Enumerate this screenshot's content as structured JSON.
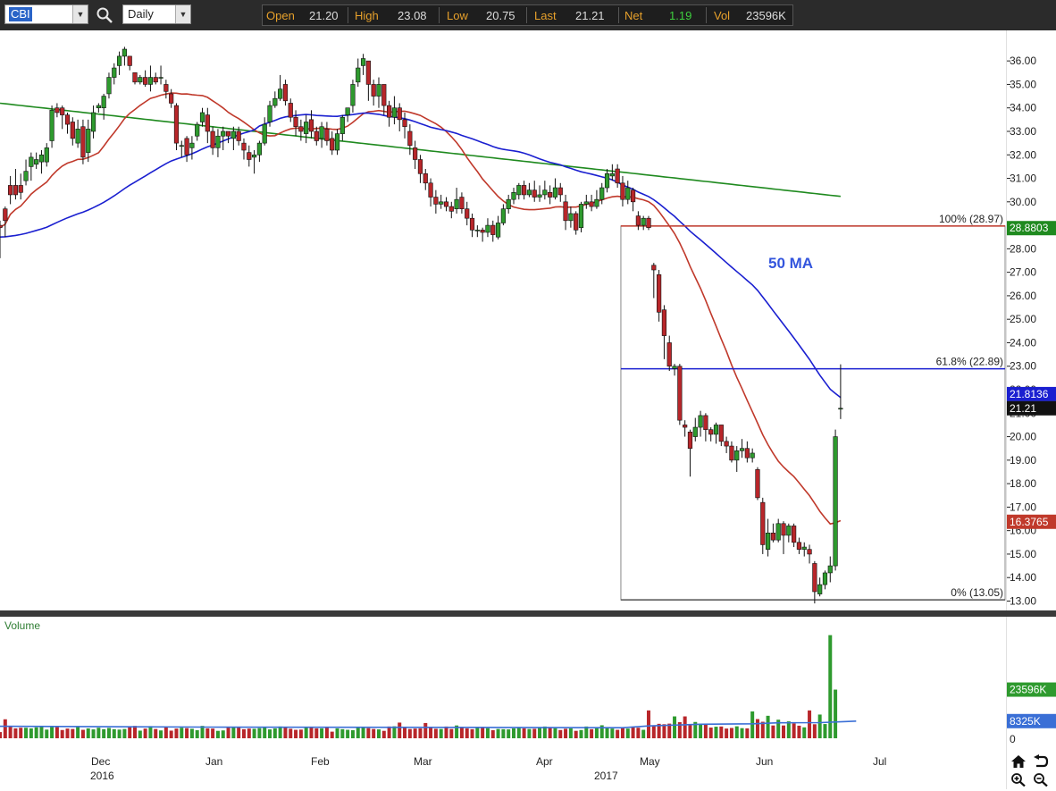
{
  "toolbar": {
    "symbol": "CBI",
    "period": "Daily",
    "quote": {
      "open_label": "Open",
      "open": "21.20",
      "high_label": "High",
      "high": "23.08",
      "low_label": "Low",
      "low": "20.75",
      "last_label": "Last",
      "last": "21.21",
      "net_label": "Net",
      "net": "1.19",
      "vol_label": "Vol",
      "vol": "23596K"
    },
    "icons": {
      "search": "search-icon",
      "dropdown": "chevron-down-icon"
    }
  },
  "colors": {
    "up": "#2e9a2e",
    "down": "#b8262a",
    "ma_short": "#c0392b",
    "ma50": "#1a1fd0",
    "ma200": "#1f8a1f",
    "fib_100": "#c0392b",
    "fib_618": "#1a1fd0",
    "volume_avg": "#3a6fd6"
  },
  "chart_data": {
    "type": "candlestick",
    "symbol": "CBI",
    "y_axis": {
      "ticks": [
        "13.00",
        "14.00",
        "15.00",
        "16.00",
        "17.00",
        "18.00",
        "19.00",
        "20.00",
        "21.00",
        "22.00",
        "23.00",
        "24.00",
        "25.00",
        "26.00",
        "27.00",
        "28.00",
        "29.00",
        "30.00",
        "31.00",
        "32.00",
        "33.00",
        "34.00",
        "35.00",
        "36.00"
      ],
      "ylim": [
        12.6,
        37.3
      ]
    },
    "x_axis": {
      "months": [
        "Dec",
        "Jan",
        "Feb",
        "Mar",
        "Apr",
        "May",
        "Jun",
        "Jul"
      ],
      "years": [
        {
          "label": "2016",
          "under": "Dec"
        },
        {
          "label": "2017",
          "under": "Apr-May"
        }
      ]
    },
    "candles": [
      [
        29.0,
        28.9,
        29.2,
        27.6
      ],
      [
        29.7,
        29.2,
        29.8,
        28.5
      ],
      [
        30.7,
        30.3,
        31.1,
        29.9
      ],
      [
        30.7,
        30.3,
        31.4,
        30.1
      ],
      [
        30.7,
        30.4,
        31.2,
        30.1
      ],
      [
        30.9,
        31.3,
        31.8,
        30.7
      ],
      [
        31.5,
        31.9,
        32.1,
        30.9
      ],
      [
        31.6,
        31.8,
        32.1,
        31.4
      ],
      [
        31.7,
        32.0,
        32.2,
        31.2
      ],
      [
        31.7,
        32.3,
        32.5,
        31.5
      ],
      [
        32.6,
        33.9,
        34.1,
        32.3
      ],
      [
        34.0,
        33.8,
        34.2,
        33.6
      ],
      [
        34.0,
        33.7,
        34.1,
        33.1
      ],
      [
        33.7,
        33.3,
        33.8,
        32.9
      ],
      [
        33.4,
        32.7,
        33.6,
        32.4
      ],
      [
        32.5,
        33.1,
        33.5,
        32.3
      ],
      [
        33.2,
        31.9,
        33.5,
        31.6
      ],
      [
        32.1,
        33.1,
        33.5,
        31.7
      ],
      [
        33.0,
        33.8,
        34.1,
        32.7
      ],
      [
        34.0,
        34.1,
        34.2,
        33.8
      ],
      [
        34.0,
        34.5,
        34.6,
        33.5
      ],
      [
        34.6,
        35.3,
        35.5,
        34.4
      ],
      [
        35.3,
        35.7,
        35.9,
        35.0
      ],
      [
        35.8,
        36.2,
        36.4,
        35.4
      ],
      [
        36.2,
        36.5,
        36.6,
        35.8
      ],
      [
        36.2,
        35.8,
        36.2,
        35.6
      ],
      [
        35.5,
        35.1,
        35.5,
        35.0
      ],
      [
        35.1,
        35.3,
        35.4,
        35.0
      ],
      [
        35.3,
        35.0,
        35.6,
        34.9
      ],
      [
        35.0,
        35.3,
        35.8,
        34.7
      ],
      [
        35.3,
        35.1,
        35.5,
        35.0
      ],
      [
        35.3,
        35.3,
        35.8,
        35.0
      ],
      [
        35.0,
        34.7,
        35.2,
        34.4
      ],
      [
        34.6,
        34.2,
        34.8,
        34.0
      ],
      [
        34.1,
        32.5,
        34.2,
        32.2
      ],
      [
        32.4,
        32.4,
        32.6,
        31.9
      ],
      [
        32.7,
        32.0,
        32.8,
        31.7
      ],
      [
        32.3,
        32.5,
        32.8,
        31.8
      ],
      [
        32.8,
        33.3,
        33.4,
        32.6
      ],
      [
        33.4,
        33.8,
        34.0,
        33.2
      ],
      [
        33.7,
        33.0,
        34.0,
        32.5
      ],
      [
        33.0,
        32.3,
        33.2,
        32.0
      ],
      [
        32.3,
        32.8,
        33.1,
        31.9
      ],
      [
        32.8,
        33.0,
        33.2,
        32.2
      ],
      [
        33.0,
        32.8,
        33.0,
        32.5
      ],
      [
        32.7,
        33.0,
        33.2,
        32.2
      ],
      [
        33.0,
        32.6,
        33.2,
        32.4
      ],
      [
        32.5,
        32.2,
        32.7,
        31.8
      ],
      [
        32.1,
        31.8,
        32.4,
        31.5
      ],
      [
        31.9,
        32.0,
        32.2,
        31.2
      ],
      [
        32.0,
        32.5,
        32.6,
        31.7
      ],
      [
        32.5,
        33.3,
        33.6,
        32.4
      ],
      [
        33.4,
        34.1,
        34.3,
        33.2
      ],
      [
        34.1,
        34.4,
        34.7,
        34.0
      ],
      [
        34.4,
        34.8,
        35.4,
        34.3
      ],
      [
        35.0,
        34.3,
        35.2,
        34.1
      ],
      [
        34.2,
        33.6,
        34.4,
        33.4
      ],
      [
        33.6,
        33.2,
        33.9,
        32.8
      ],
      [
        33.2,
        33.0,
        33.5,
        32.6
      ],
      [
        32.9,
        33.4,
        33.7,
        32.5
      ],
      [
        33.5,
        33.0,
        33.9,
        32.7
      ],
      [
        33.0,
        32.6,
        33.2,
        32.4
      ],
      [
        32.7,
        33.2,
        33.4,
        32.3
      ],
      [
        33.1,
        32.6,
        33.4,
        32.4
      ],
      [
        32.7,
        32.2,
        33.0,
        32.0
      ],
      [
        32.2,
        32.9,
        33.1,
        32.0
      ],
      [
        32.9,
        33.6,
        33.7,
        32.6
      ],
      [
        33.7,
        34.0,
        34.0,
        33.4
      ],
      [
        34.1,
        35.0,
        35.2,
        33.8
      ],
      [
        35.1,
        35.7,
        36.1,
        34.9
      ],
      [
        35.8,
        36.1,
        36.3,
        35.4
      ],
      [
        36.0,
        35.0,
        36.0,
        34.3
      ],
      [
        35.0,
        34.5,
        35.2,
        34.1
      ],
      [
        34.5,
        35.0,
        35.3,
        34.0
      ],
      [
        35.0,
        34.1,
        35.0,
        33.7
      ],
      [
        34.1,
        33.6,
        34.3,
        33.2
      ],
      [
        33.6,
        34.0,
        34.5,
        33.3
      ],
      [
        34.0,
        33.5,
        34.2,
        33.0
      ],
      [
        33.5,
        33.2,
        33.8,
        32.7
      ],
      [
        33.0,
        32.4,
        33.3,
        32.0
      ],
      [
        32.3,
        31.8,
        32.6,
        31.4
      ],
      [
        31.8,
        31.2,
        32.0,
        30.8
      ],
      [
        31.2,
        30.8,
        31.4,
        30.5
      ],
      [
        30.8,
        30.2,
        31.0,
        29.8
      ],
      [
        30.2,
        29.9,
        30.5,
        29.5
      ],
      [
        29.9,
        30.0,
        30.3,
        29.7
      ],
      [
        30.0,
        29.8,
        30.2,
        29.6
      ],
      [
        29.8,
        29.6,
        30.0,
        29.3
      ],
      [
        29.7,
        30.1,
        30.6,
        29.5
      ],
      [
        30.2,
        29.7,
        30.4,
        29.5
      ],
      [
        29.7,
        29.3,
        30.0,
        29.0
      ],
      [
        29.3,
        28.8,
        29.5,
        28.5
      ],
      [
        28.8,
        28.8,
        29.0,
        28.5
      ],
      [
        28.8,
        28.7,
        28.9,
        28.3
      ],
      [
        28.7,
        29.0,
        29.3,
        28.5
      ],
      [
        29.0,
        28.6,
        29.2,
        28.3
      ],
      [
        28.5,
        29.1,
        29.4,
        28.4
      ],
      [
        29.1,
        29.7,
        29.9,
        29.0
      ],
      [
        29.7,
        30.1,
        30.3,
        29.5
      ],
      [
        30.1,
        30.4,
        30.6,
        29.9
      ],
      [
        30.3,
        30.7,
        30.8,
        30.1
      ],
      [
        30.7,
        30.3,
        30.9,
        30.1
      ],
      [
        30.3,
        30.5,
        30.8,
        30.2
      ],
      [
        30.5,
        30.2,
        30.9,
        30.0
      ],
      [
        30.2,
        30.3,
        30.7,
        30.0
      ],
      [
        30.3,
        30.5,
        30.9,
        30.1
      ],
      [
        30.4,
        30.2,
        30.7,
        29.9
      ],
      [
        30.2,
        30.6,
        31.0,
        30.1
      ],
      [
        30.6,
        30.3,
        30.8,
        30.0
      ],
      [
        30.0,
        29.2,
        30.3,
        28.8
      ],
      [
        29.2,
        29.5,
        29.8,
        28.9
      ],
      [
        29.5,
        28.8,
        29.6,
        28.6
      ],
      [
        28.9,
        29.9,
        30.0,
        28.7
      ],
      [
        29.9,
        30.0,
        30.3,
        29.7
      ],
      [
        30.0,
        29.8,
        30.3,
        29.6
      ],
      [
        29.8,
        30.1,
        30.5,
        29.7
      ],
      [
        30.1,
        30.6,
        30.8,
        29.9
      ],
      [
        30.6,
        31.2,
        31.4,
        30.4
      ],
      [
        31.1,
        31.2,
        31.6,
        30.9
      ],
      [
        31.4,
        30.8,
        31.6,
        30.6
      ],
      [
        30.8,
        30.1,
        31.1,
        29.8
      ],
      [
        30.1,
        30.6,
        30.9,
        29.9
      ],
      [
        30.5,
        30.0,
        30.6,
        29.6
      ],
      [
        29.4,
        29.0,
        29.6,
        28.8
      ],
      [
        29.0,
        29.3,
        29.4,
        28.8
      ],
      [
        29.3,
        28.9,
        29.4,
        28.8
      ],
      [
        27.3,
        27.1,
        27.4,
        25.9
      ],
      [
        26.9,
        25.3,
        27.1,
        24.9
      ],
      [
        25.4,
        24.3,
        25.6,
        23.3
      ],
      [
        24.0,
        23.0,
        24.3,
        22.8
      ],
      [
        22.9,
        23.0,
        23.1,
        22.6
      ],
      [
        23.0,
        20.7,
        23.1,
        20.5
      ],
      [
        20.5,
        20.4,
        20.7,
        20.0
      ],
      [
        20.2,
        19.5,
        20.3,
        18.3
      ],
      [
        20.0,
        20.4,
        20.8,
        19.8
      ],
      [
        20.4,
        20.9,
        21.1,
        20.0
      ],
      [
        20.9,
        20.3,
        21.0,
        19.8
      ],
      [
        20.3,
        20.1,
        20.4,
        19.8
      ],
      [
        20.1,
        20.5,
        20.6,
        19.7
      ],
      [
        20.5,
        19.8,
        20.5,
        19.6
      ],
      [
        19.8,
        19.6,
        20.0,
        19.3
      ],
      [
        19.6,
        19.0,
        19.8,
        18.9
      ],
      [
        19.0,
        19.4,
        19.6,
        18.5
      ],
      [
        19.4,
        19.5,
        19.9,
        19.1
      ],
      [
        19.5,
        19.1,
        19.8,
        18.9
      ],
      [
        19.1,
        19.3,
        19.5,
        18.9
      ],
      [
        18.6,
        17.4,
        18.7,
        17.3
      ],
      [
        17.2,
        15.4,
        17.4,
        15.0
      ],
      [
        15.2,
        15.9,
        16.5,
        14.9
      ],
      [
        15.9,
        15.6,
        16.3,
        15.5
      ],
      [
        15.6,
        16.3,
        16.5,
        15.5
      ],
      [
        16.3,
        15.8,
        16.4,
        15.0
      ],
      [
        15.8,
        16.2,
        16.3,
        15.5
      ],
      [
        16.2,
        15.5,
        16.3,
        15.3
      ],
      [
        15.5,
        15.2,
        15.7,
        15.0
      ],
      [
        15.2,
        15.3,
        15.5,
        14.9
      ],
      [
        15.2,
        15.0,
        15.4,
        14.6
      ],
      [
        14.6,
        13.4,
        14.7,
        12.9
      ],
      [
        13.3,
        13.7,
        14.0,
        13.2
      ],
      [
        13.7,
        14.2,
        14.3,
        13.5
      ],
      [
        14.2,
        14.5,
        14.9,
        13.8
      ],
      [
        14.5,
        20.0,
        20.3,
        14.3
      ],
      [
        21.2,
        21.21,
        23.08,
        20.75
      ]
    ],
    "moving_averages": [
      {
        "name": "50 MA",
        "period": 50,
        "color": "#1a1fd0"
      },
      {
        "period": 20,
        "color": "#c0392b"
      },
      {
        "period": 200,
        "color": "#1f8a1f"
      }
    ],
    "price_labels": [
      {
        "value": 28.8803,
        "text": "28.8803",
        "color": "#1f8a1f"
      },
      {
        "value": 21.8136,
        "text": "21.8136",
        "color": "#1a1fd0"
      },
      {
        "value": 21.21,
        "text": "21.21",
        "color": "#111111"
      },
      {
        "value": 16.3765,
        "text": "16.3765",
        "color": "#c0392b"
      }
    ],
    "fibonacci": {
      "levels": [
        {
          "label": "100% (28.97)",
          "value": 28.97,
          "color": "#c0392b"
        },
        {
          "label": "61.8% (22.89)",
          "value": 22.89,
          "color": "#1a1fd0"
        },
        {
          "label": "0% (13.05)",
          "value": 13.05,
          "color": "#555555"
        }
      ]
    },
    "annotation": "50 MA",
    "volume": {
      "title": "Volume",
      "ticks": [
        "0",
        "8325K",
        "23596K"
      ],
      "last": 23596,
      "avg": 8325,
      "ylim": [
        0,
        52000
      ],
      "bars": [
        3000,
        9200,
        5600,
        4800,
        5100,
        5100,
        4800,
        5300,
        6000,
        4200,
        5400,
        5400,
        4000,
        4700,
        4500,
        5600,
        4100,
        4800,
        4300,
        5100,
        4400,
        5000,
        4400,
        4200,
        4500,
        5600,
        6000,
        3700,
        4700,
        5900,
        4500,
        3800,
        5300,
        3700,
        4700,
        5100,
        4900,
        4600,
        3900,
        6000,
        4800,
        4700,
        3600,
        3800,
        5300,
        5200,
        5500,
        4400,
        4700,
        4600,
        4900,
        5600,
        4300,
        4800,
        5700,
        5200,
        4600,
        4100,
        4200,
        5300,
        5300,
        4800,
        4800,
        5300,
        3200,
        4800,
        4400,
        4100,
        3900,
        5300,
        5400,
        4900,
        4500,
        4300,
        3600,
        5700,
        5800,
        7600,
        5000,
        4500,
        4700,
        4800,
        7400,
        5300,
        4600,
        4500,
        5700,
        4500,
        6200,
        5100,
        4800,
        4400,
        5300,
        5500,
        4900,
        3900,
        4500,
        4400,
        4300,
        4800,
        5000,
        4800,
        4500,
        4600,
        5100,
        5700,
        5400,
        4900,
        4000,
        4600,
        4800,
        3600,
        4000,
        5700,
        4400,
        4900,
        6300,
        5000,
        4700,
        4100,
        5000,
        4700,
        5400,
        5100,
        4100,
        13500,
        5900,
        7000,
        6800,
        7100,
        10600,
        7800,
        10600,
        6800,
        7900,
        6800,
        6700,
        5200,
        5600,
        5700,
        4700,
        5000,
        5800,
        4900,
        4800,
        13000,
        9300,
        8000,
        10900,
        6200,
        9000,
        6200,
        8200,
        7200,
        6100,
        5300,
        13500,
        6800,
        11500,
        6900,
        50000,
        23596
      ],
      "avg_line": [
        [
          0,
          5800
        ],
        [
          40,
          5400
        ],
        [
          90,
          5300
        ],
        [
          120,
          5100
        ],
        [
          125,
          6000
        ],
        [
          135,
          6800
        ],
        [
          145,
          7000
        ],
        [
          150,
          7500
        ],
        [
          158,
          7600
        ],
        [
          163,
          8100
        ],
        [
          165,
          8325
        ]
      ]
    }
  },
  "nav": {
    "home": "home-icon",
    "undo": "undo-icon",
    "zoom_in": "zoom-in-icon",
    "zoom_out": "zoom-out-icon"
  }
}
